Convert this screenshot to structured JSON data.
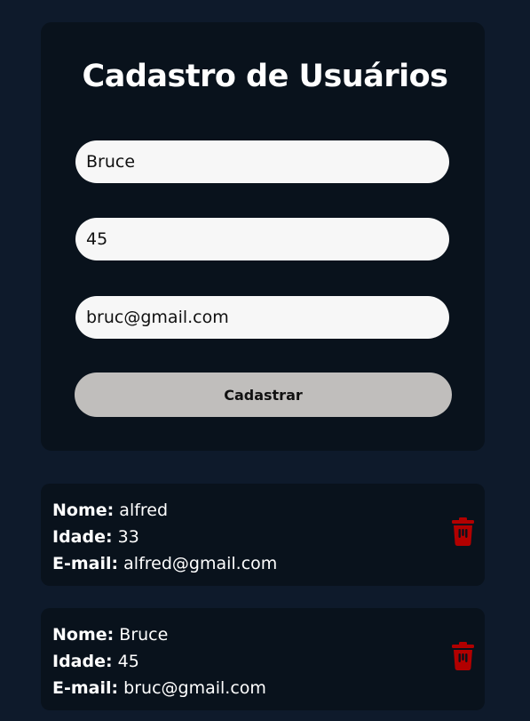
{
  "form": {
    "title": "Cadastro de Usuários",
    "name_value": "Bruce",
    "age_value": "45",
    "email_value": "bruc@gmail.com",
    "submit_label": "Cadastrar"
  },
  "users": [
    {
      "name_label": "Nome:",
      "name": "alfred",
      "age_label": "Idade:",
      "age": "33",
      "email_label": "E-mail:",
      "email": "alfred@gmail.com"
    },
    {
      "name_label": "Nome:",
      "name": "Bruce",
      "age_label": "Idade:",
      "age": "45",
      "email_label": "E-mail:",
      "email": "bruc@gmail.com"
    }
  ],
  "icons": {
    "delete": "trash-icon"
  },
  "colors": {
    "background": "#0e1a2b",
    "card": "#09121c",
    "input": "#f7f7f7",
    "button": "#c0bebc",
    "delete_icon": "#b20000"
  }
}
